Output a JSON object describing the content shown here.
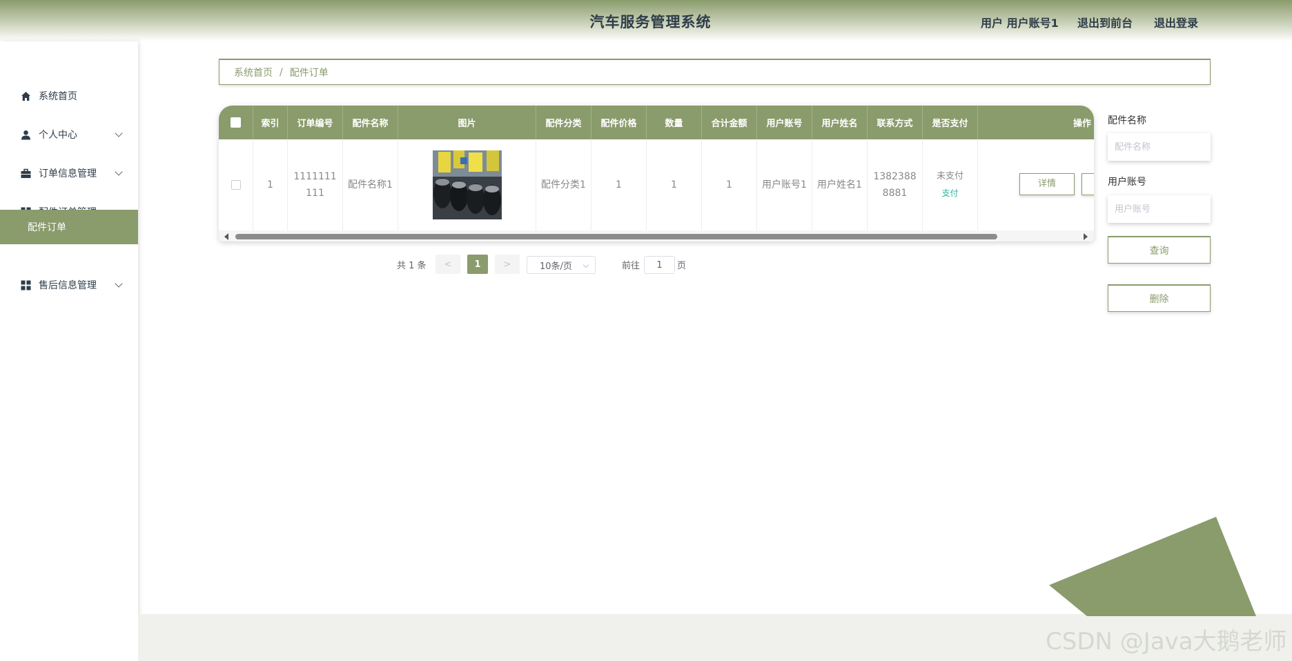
{
  "header": {
    "title": "汽车服务管理系统",
    "user": "用户 用户账号1",
    "front": "退出到前台",
    "logout": "退出登录"
  },
  "sidebar": {
    "items": [
      {
        "label": "系统首页",
        "icon": "home-icon"
      },
      {
        "label": "个人中心",
        "icon": "user-icon"
      },
      {
        "label": "订单信息管理",
        "icon": "briefcase-icon"
      },
      {
        "label": "配件订单管理",
        "icon": "grid-icon"
      },
      {
        "label": "配件订单",
        "icon": ""
      },
      {
        "label": "售后信息管理",
        "icon": "grid-icon"
      }
    ]
  },
  "breadcrumb": {
    "home": "系统首页",
    "separator": "/",
    "current": "配件订单"
  },
  "table": {
    "headers": [
      "索引",
      "订单编号",
      "配件名称",
      "图片",
      "配件分类",
      "配件价格",
      "数量",
      "合计金额",
      "用户账号",
      "用户姓名",
      "联系方式",
      "是否支付",
      "操作"
    ],
    "rows": [
      {
        "index": "1",
        "order_no": "1111111111",
        "part_name": "配件名称1",
        "category": "配件分类1",
        "price": "1",
        "quantity": "1",
        "total": "1",
        "account": "用户账号1",
        "name": "用户姓名1",
        "phone": "13823888881",
        "paid": "未支付",
        "pay_link": "支付",
        "detail_button": "详情"
      }
    ]
  },
  "pagination": {
    "total": "共 1 条",
    "prev": "<",
    "current": "1",
    "next": ">",
    "page_size": "10条/页",
    "goto": "前往",
    "goto_value": "1",
    "page_unit": "页"
  },
  "search": {
    "part_name_label": "配件名称",
    "part_name_placeholder": "配件名称",
    "account_label": "用户账号",
    "account_placeholder": "用户账号",
    "query_button": "查询",
    "delete_button": "删除"
  },
  "watermark": "CSDN @Java大鹅老师",
  "colors": {
    "accent": "#8a9b6c",
    "paid_link": "#2bb39b"
  }
}
